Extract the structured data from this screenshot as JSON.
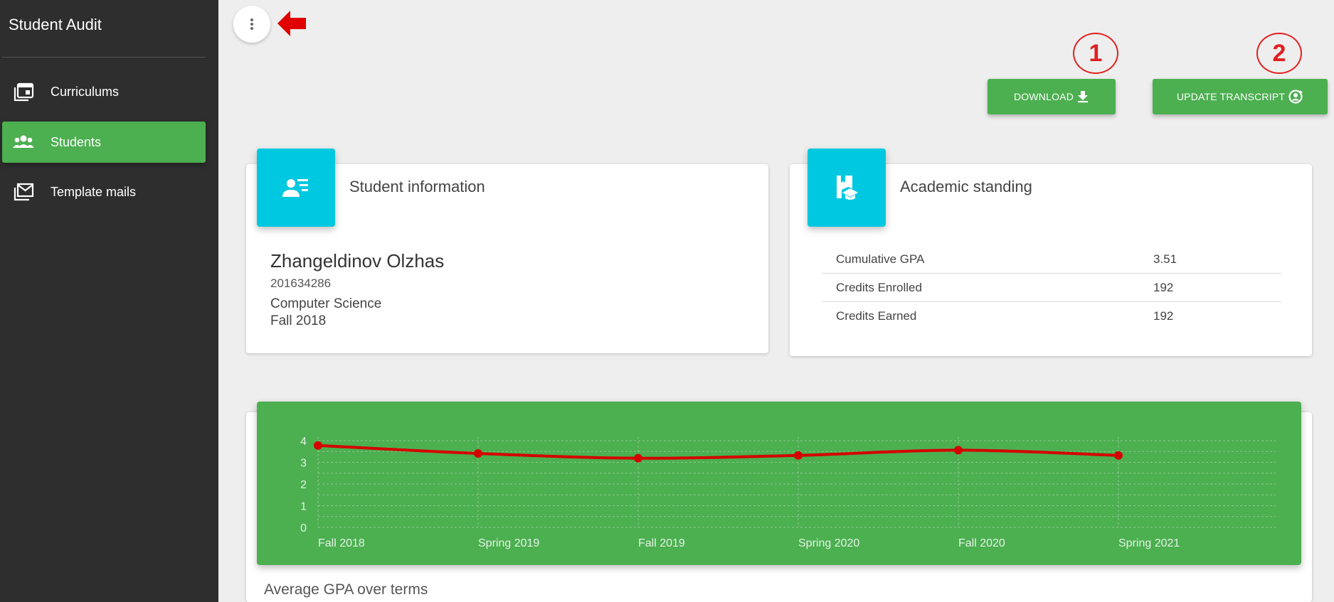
{
  "sidebar": {
    "brand": "Student Audit",
    "items": [
      {
        "label": "Curriculums",
        "icon": "calendar-stack-icon",
        "active": false
      },
      {
        "label": "Students",
        "icon": "people-icon",
        "active": true
      },
      {
        "label": "Template mails",
        "icon": "mail-stack-icon",
        "active": false
      }
    ]
  },
  "toolbar": {
    "download_label": "DOWNLOAD",
    "update_label": "UPDATE TRANSCRIPT"
  },
  "annotations": {
    "callout_1": "1",
    "callout_2": "2"
  },
  "student": {
    "card_title": "Student information",
    "name": "Zhangeldinov Olzhas",
    "id": "201634286",
    "major": "Computer Science",
    "term": "Fall 2018"
  },
  "academic": {
    "card_title": "Academic standing",
    "rows": [
      {
        "label": "Cumulative GPA",
        "value": "3.51"
      },
      {
        "label": "Credits Enrolled",
        "value": "192"
      },
      {
        "label": "Credits Earned",
        "value": "192"
      }
    ]
  },
  "chart_title": "Average GPA over terms",
  "colors": {
    "sidebar_bg": "#2e2e2e",
    "accent_green": "#4caf50",
    "icon_cyan": "#00c8e0",
    "line_red": "#d50000",
    "callout_red": "#e02020"
  },
  "chart_data": {
    "type": "line",
    "categories": [
      "Fall 2018",
      "Spring 2019",
      "Fall 2019",
      "Spring 2020",
      "Fall 2020",
      "Spring 2021"
    ],
    "series": [
      {
        "values": [
          3.78,
          3.41,
          3.19,
          3.32,
          3.56,
          3.32
        ]
      }
    ],
    "ylim": [
      0,
      4
    ],
    "yticks": [
      0,
      1,
      2,
      3,
      4
    ],
    "grid": true,
    "title": "Average GPA over terms"
  }
}
